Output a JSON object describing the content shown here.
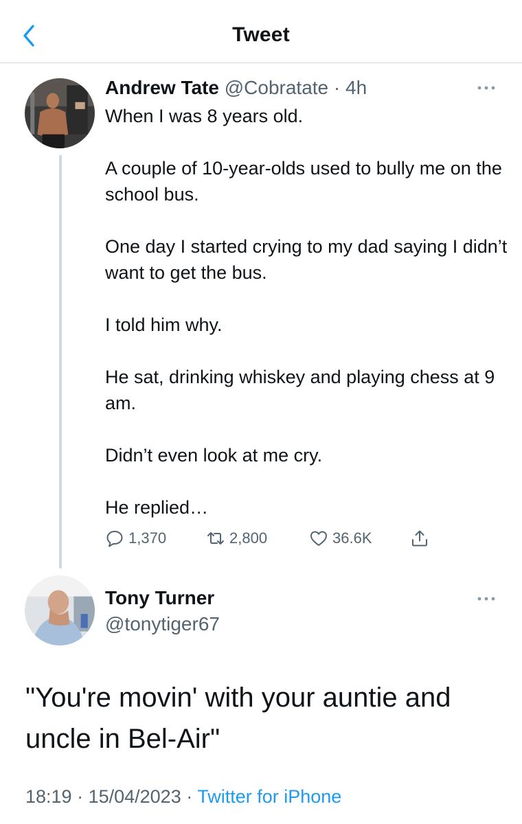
{
  "header": {
    "title": "Tweet"
  },
  "tweet1": {
    "name": "Andrew Tate",
    "handle": "@Cobratate",
    "separator": "·",
    "time": "4h",
    "paragraphs": [
      "When I was 8 years old.",
      "A couple of 10-year-olds used to bully me on the school bus.",
      "One day I started crying to my dad saying I didn’t want to get the bus.",
      "I told him why.",
      "He sat, drinking whiskey and playing chess at 9 am.",
      "Didn’t even look at me cry.",
      "He replied…"
    ],
    "stats": {
      "replies": "1,370",
      "retweets": "2,800",
      "likes": "36.6K"
    },
    "more_icon": "more-horizontal-icon"
  },
  "tweet2": {
    "name": "Tony Turner",
    "handle": "@tonytiger67",
    "body": "\"You're movin' with your auntie and uncle in Bel-Air\"",
    "time": "18:19",
    "sep1": " · ",
    "date": "15/04/2023",
    "sep2": " · ",
    "source": "Twitter for iPhone"
  },
  "colors": {
    "accent": "#1d9bf0",
    "muted": "#536471",
    "text": "#0f1419",
    "divider": "#cfd9de"
  },
  "icons": [
    "back-chevron-icon",
    "reply-icon",
    "retweet-icon",
    "like-icon",
    "share-icon",
    "more-horizontal-icon"
  ]
}
